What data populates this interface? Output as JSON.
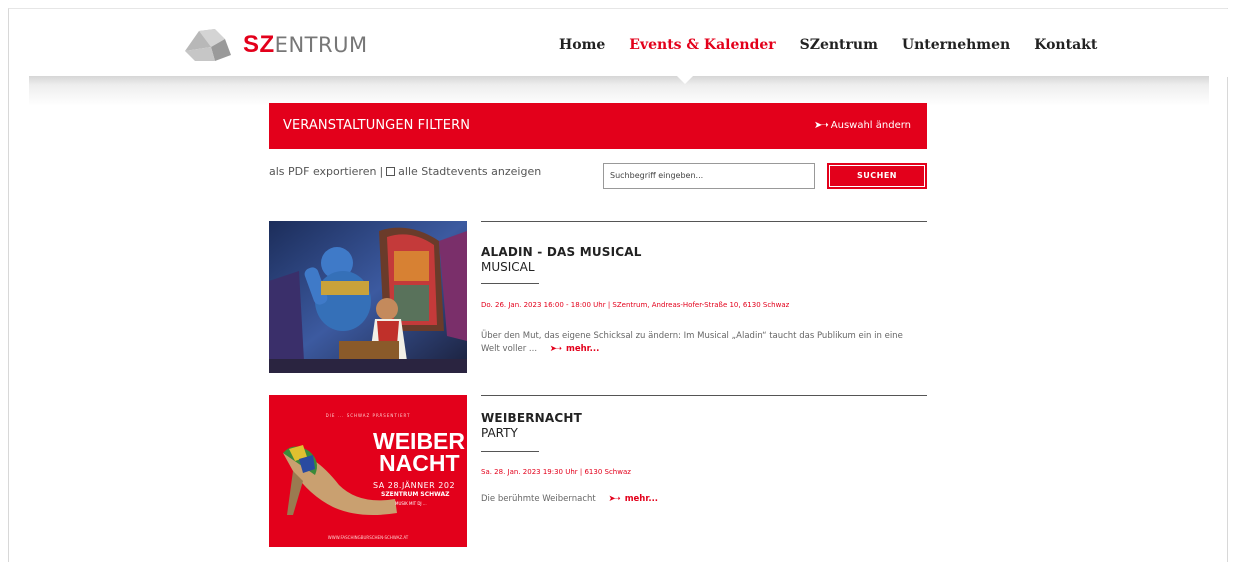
{
  "logo": {
    "sz": "SZ",
    "rest": "ENTRUM"
  },
  "nav": [
    {
      "label": "Home",
      "active": false
    },
    {
      "label": "Events & Kalender",
      "active": true
    },
    {
      "label": "SZentrum",
      "active": false
    },
    {
      "label": "Unternehmen",
      "active": false
    },
    {
      "label": "Kontakt",
      "active": false
    }
  ],
  "filter": {
    "title": "VERANSTALTUNGEN FILTERN",
    "change_arrow": "➤➝",
    "change_label": "Auswahl ändern"
  },
  "tools": {
    "pdf_label": "als PDF exportieren",
    "separator": "|",
    "stadtevents_label": "alle Stadtevents anzeigen"
  },
  "search": {
    "placeholder": "Suchbegriff eingeben...",
    "button_label": "SUCHEN"
  },
  "events": [
    {
      "title": "ALADIN - DAS MUSICAL",
      "category": "MUSICAL",
      "date": "Do. 26. Jan. 2023 16:00 - 18:00 Uhr | SZentrum, Andreas-Hofer-Straße 10, 6130 Schwaz",
      "description": "Über den Mut, das eigene Schicksal zu ändern: Im Musical „Aladin“ taucht das Publikum ein in eine Welt voller ...",
      "more": "mehr..."
    },
    {
      "title": "WEIBERNACHT",
      "category": "PARTY",
      "date": "Sa. 28. Jan. 2023 19:30 Uhr | 6130 Schwaz",
      "description": "Die berühmte Weibernacht",
      "more": "mehr...",
      "poster": {
        "small_header": "DIE ... SCHWAZ PRÄSENTIERT",
        "line1": "WEIBER",
        "line2": "NACHT",
        "date_line": "SA 28.JÄNNER 202",
        "venue": "SZENTRUM SCHWAZ",
        "music": "MUSIK MIT DJ ...",
        "url": "WWW.FASCHINGBURSCHEN-SCHWAZ.AT"
      }
    }
  ],
  "colors": {
    "brand_red": "#e3001b"
  }
}
